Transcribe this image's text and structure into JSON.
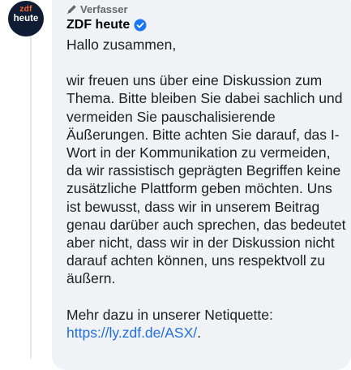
{
  "comment": {
    "author_badge": "Verfasser",
    "author_name": "ZDF heute",
    "avatar": {
      "line1": "zdf",
      "line2": "heute"
    },
    "paragraphs": [
      "Hallo zusammen,",
      "wir freuen uns über eine Diskussion zum Thema. Bitte bleiben Sie dabei sachlich und vermeiden Sie pauschalisierende Äußerungen. Bitte achten Sie darauf, das I-Wort in der Kommunikation zu vermeiden, da wir rassistisch geprägten Begriffen keine zusätzliche Plattform geben möchten. Uns ist bewusst, dass wir in unserem Beitrag genau darüber auch sprechen, das bedeutet aber nicht, dass wir in der Diskussion nicht darauf achten können, uns respektvoll zu äußern."
    ],
    "netiquette_text": "Mehr dazu in unserer Netiquette: ",
    "netiquette_link": "https://ly.zdf.de/ASX/",
    "netiquette_end": "."
  },
  "icons": {
    "author_badge_icon": "pen-icon",
    "verified_icon": "verified-checkmark-icon"
  },
  "colors": {
    "bubble": "#f0f2f5",
    "text": "#1c1e21",
    "muted": "#65676b",
    "link": "#216fdb",
    "verified": "#1877f2",
    "avatar_bg": "#101c33",
    "avatar_accent": "#ff6a2a"
  }
}
